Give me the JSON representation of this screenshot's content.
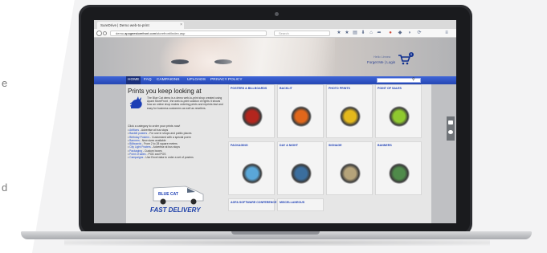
{
  "side_text": {
    "top_letter": "e",
    "bottom_letter": "d"
  },
  "browser": {
    "tab_title": "SureDrive | Demo web-to-print",
    "tab_close": "×",
    "url_prefix": "demo.",
    "url_domain": "apogeestorefront.com",
    "url_path": "/storefront/index.asp",
    "search_placeholder": "Search"
  },
  "header": {
    "user_name": "Hello Linnea",
    "forget_me": "Forget Me",
    "separator": "|",
    "login": "Login",
    "cart_count": "0"
  },
  "menu": {
    "items": [
      {
        "label": "HOME",
        "active": true
      },
      {
        "label": "FAQ",
        "active": false
      },
      {
        "label": "CAMPAIGNS",
        "active": false
      },
      {
        "label": "UPLOADS",
        "active": false
      },
      {
        "label": "PRIVACY POLICY",
        "active": false
      }
    ],
    "search_icon": "search-icon"
  },
  "intro": {
    "title": "Prints you keep looking at",
    "text": "The Blue Cat demo is a demo web-to-print shop created using Apant StoreFront , the web-to-print solution of rights It shows how an online shop makes ordering prints and reprints fast and easy for business customers as well as resellers.",
    "category_heading": "Click a category to order your prints now!",
    "categories": [
      {
        "name": "Artifices",
        "desc": " - Advertise at bus stops"
      },
      {
        "name": "Backlit posters",
        "desc": " - For use in shops and public places"
      },
      {
        "name": "Birthday Posters",
        "desc": " - Customized with a special poem"
      },
      {
        "name": "Banners",
        "desc": " - New sizes available"
      },
      {
        "name": "Billboards",
        "desc": " - From 2 to 28 square meters"
      },
      {
        "name": "City Light Posters",
        "desc": " - Advertise at bus stops"
      },
      {
        "name": "Packaging",
        "desc": " - Custom boxes"
      },
      {
        "name": "Point of sales",
        "desc": " - POD and POS"
      },
      {
        "name": "Campaigns",
        "desc": " - Use Excel data to order a set of posters"
      }
    ],
    "van_label": "BLUE CAT",
    "delivery": "FAST DELIVERY"
  },
  "cards": [
    {
      "title": "POSTERS & BILLBOARDS",
      "color": "#b3261e"
    },
    {
      "title": "BACKLIT",
      "color": "#e0671b"
    },
    {
      "title": "PHOTO PRINTS",
      "color": "#e3b81c"
    },
    {
      "title": "POINT OF SALES",
      "color": "#8fc92f"
    },
    {
      "title": "PACKAGING",
      "color": "#5aa7d8"
    },
    {
      "title": "DAY & NIGHT",
      "color": "#3b6e9e"
    },
    {
      "title": "SIGNAGE",
      "color": "#b5a37a"
    },
    {
      "title": "BANNERS",
      "color": "#4f8a4a"
    },
    {
      "title": "AGFA SOFTWARE CONFERENCE",
      "color": "#cccccc"
    },
    {
      "title": "MISCELLANEOUS",
      "color": "#cccccc"
    }
  ]
}
